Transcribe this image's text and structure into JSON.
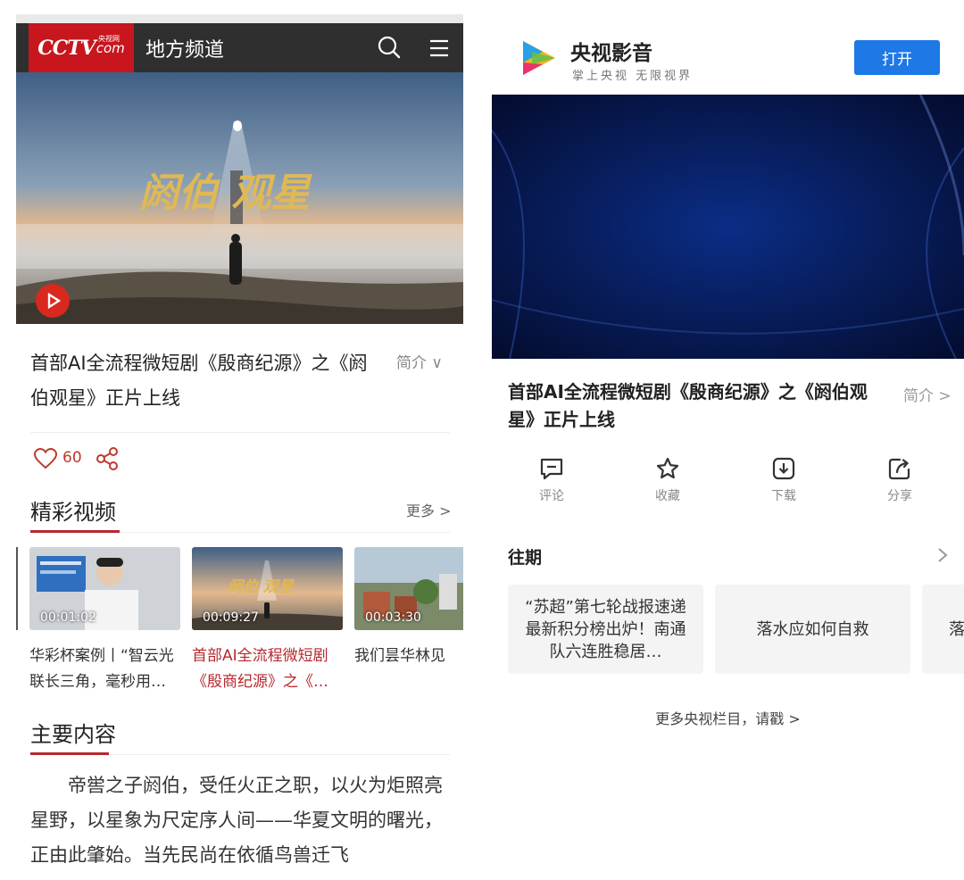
{
  "left": {
    "header": {
      "logo_main": "CCTV",
      "logo_sub": "央视网",
      "logo_suffix": "com",
      "title": "地方频道"
    },
    "hero": {
      "title_text": "阏伯  观星"
    },
    "headline": "首部AI全流程微短剧《殷商纪源》之《阏伯观星》正片上线",
    "intro_label": "简介 ∨",
    "likes": "60",
    "section_videos": {
      "title": "精彩视频",
      "more": "更多 >"
    },
    "videos": [
      {
        "duration": "00:01:02",
        "caption": "华彩杯案例丨“智云光联长三角，毫秒用…"
      },
      {
        "duration": "00:09:27",
        "caption": "首部AI全流程微短剧《殷商纪源》之《…"
      },
      {
        "duration": "00:03:30",
        "caption": "我们昙华林见"
      }
    ],
    "section_main": {
      "title": "主要内容"
    },
    "body": "帝喾之子阏伯，受任火正之职，以火为炬照亮星野，以星象为尺定序人间——华夏文明的曙光，正由此肇始。当先民尚在依循鸟兽迁飞"
  },
  "right": {
    "app_name": "央视影音",
    "slogan": "掌上央视 无限视界",
    "open_label": "打开",
    "headline": "首部AI全流程微短剧《殷商纪源》之《阏伯观星》正片上线",
    "intro_label": "简介 >",
    "actions": [
      {
        "icon": "comment-icon",
        "label": "评论"
      },
      {
        "icon": "star-icon",
        "label": "收藏"
      },
      {
        "icon": "download-icon",
        "label": "下载"
      },
      {
        "icon": "share-icon",
        "label": "分享"
      }
    ],
    "past_label": "往期",
    "cards": [
      "“苏超”第七轮战报速递 最新积分榜出炉！南通队六连胜稳居…",
      "落水应如何自救",
      "落"
    ],
    "footer": "更多央视栏目，请戳 >"
  },
  "colors": {
    "cctv_red": "#c8161e",
    "accent_red": "#b5282e",
    "open_blue": "#1e78e6",
    "header_dark": "#2f2f2f"
  }
}
